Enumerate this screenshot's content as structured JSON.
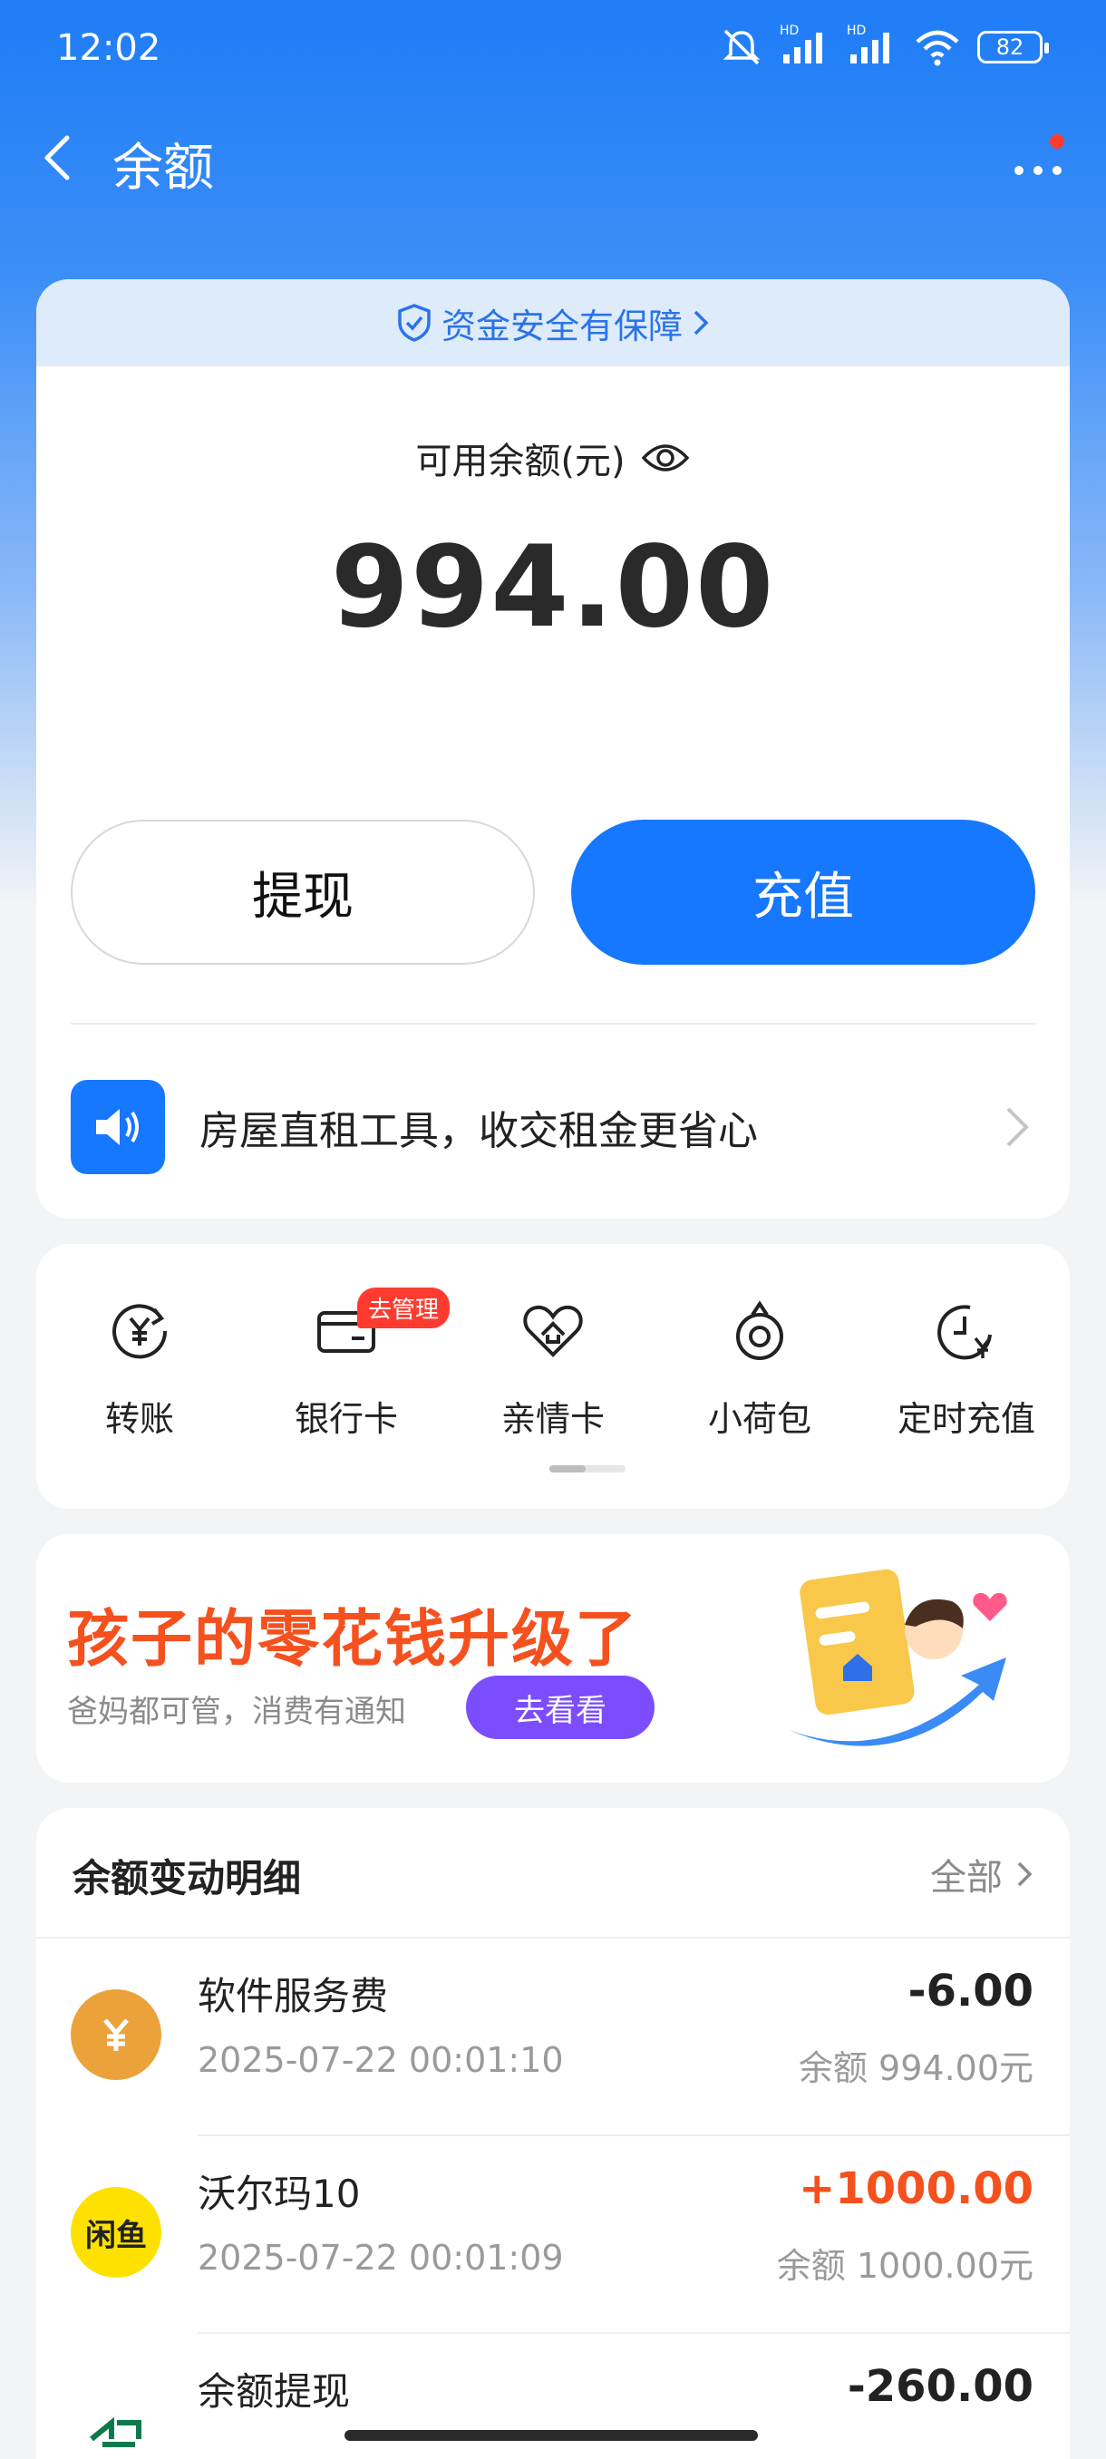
{
  "status_bar": {
    "time": "12:02",
    "battery": "82",
    "signal_label_1": "HD",
    "signal_label_2": "HD"
  },
  "header": {
    "title": "余额"
  },
  "balance_card": {
    "security_text": "资金安全有保障",
    "balance_label": "可用余额(元)",
    "balance_value": "994.00",
    "withdraw_label": "提现",
    "recharge_label": "充值",
    "promo_text": "房屋直租工具，收交租金更省心"
  },
  "tools": [
    {
      "label": "转账",
      "icon": "transfer-yuan-icon"
    },
    {
      "label": "银行卡",
      "icon": "bank-card-icon",
      "badge": "去管理"
    },
    {
      "label": "亲情卡",
      "icon": "family-card-heart-icon"
    },
    {
      "label": "小荷包",
      "icon": "pouch-icon"
    },
    {
      "label": "定时充值",
      "icon": "scheduled-recharge-icon"
    }
  ],
  "banner": {
    "title": "孩子的零花钱升级了",
    "subtitle": "爸妈都可管，消费有通知",
    "button_label": "去看看"
  },
  "records": {
    "title": "余额变动明细",
    "all_label": "全部",
    "items": [
      {
        "name": "软件服务费",
        "time": "2025-07-22 00:01:10",
        "amount": "-6.00",
        "balance": "余额 994.00元",
        "avatar": "yuan-coin-icon",
        "avatar_color": "#eba23a"
      },
      {
        "name": "沃尔玛10",
        "time": "2025-07-22 00:01:09",
        "amount": "+1000.00",
        "balance": "余额 1000.00元",
        "avatar": "xianyu-logo-icon",
        "avatar_color": "#ffe100",
        "avatar_text": "闲鱼"
      },
      {
        "name": "余额提现",
        "time": "",
        "amount": "-260.00",
        "balance": "",
        "avatar": "bank-logo-icon",
        "avatar_color": "#0b7a4b"
      }
    ]
  },
  "colors": {
    "primary": "#1677ff",
    "accent_orange": "#f4511e",
    "purple": "#7c4dff"
  }
}
